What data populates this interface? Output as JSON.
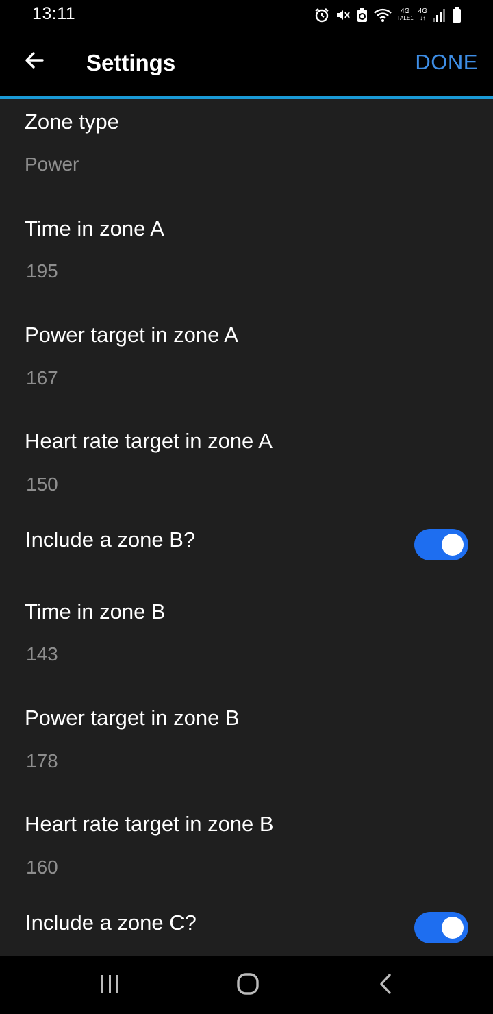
{
  "status_bar": {
    "time": "13:11",
    "network_1": "4G",
    "network_1_sub": "TALE1",
    "network_2": "4G",
    "icons": [
      "alarm-icon",
      "mute-icon",
      "battery-saver-icon",
      "wifi-icon",
      "signal-icon",
      "battery-icon"
    ]
  },
  "app_bar": {
    "back_icon": "arrow-left-icon",
    "title": "Settings",
    "done_label": "DONE",
    "accent_color": "#1a9ad6",
    "done_color": "#3e8ee6"
  },
  "settings": {
    "zone_type": {
      "title": "Zone type",
      "value": "Power"
    },
    "time_zone_a": {
      "title": "Time in zone A",
      "value": "195"
    },
    "power_zone_a": {
      "title": "Power target in zone A",
      "value": "167"
    },
    "hr_zone_a": {
      "title": "Heart rate target in zone A",
      "value": "150"
    },
    "include_zone_b": {
      "title": "Include a zone B?",
      "checked": true
    },
    "time_zone_b": {
      "title": "Time in zone B",
      "value": "143"
    },
    "power_zone_b": {
      "title": "Power target in zone B",
      "value": "178"
    },
    "hr_zone_b": {
      "title": "Heart rate target in zone B",
      "value": "160"
    },
    "include_zone_c": {
      "title": "Include a zone C?",
      "checked": true
    }
  },
  "toggle_color": "#1e6ef0",
  "nav_bar": {
    "icons": [
      "recent-apps-icon",
      "home-icon",
      "back-icon"
    ]
  }
}
